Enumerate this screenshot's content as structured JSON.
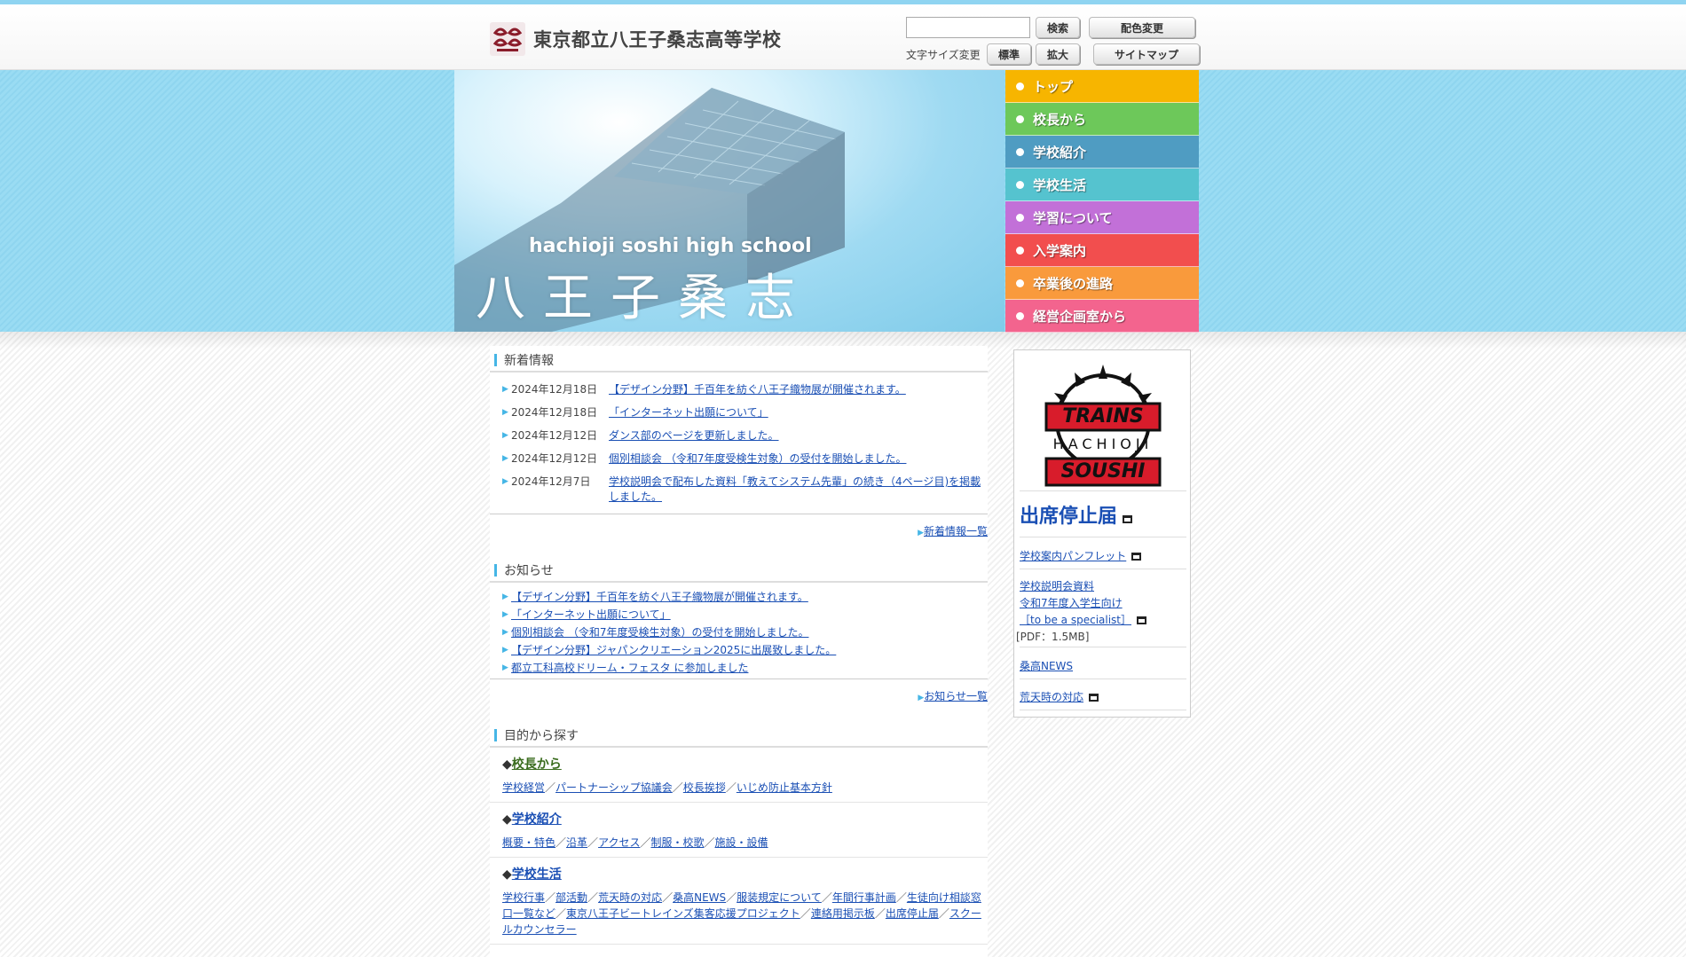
{
  "header": {
    "site_title": "東京都立八王子桑志高等学校",
    "search_placeholder": "",
    "search_button": "検索",
    "color_button": "配色変更",
    "font_size_label": "文字サイズ変更",
    "font_normal_button": "標準",
    "font_large_button": "拡大",
    "sitemap_button": "サイトマップ"
  },
  "hero": {
    "subtitle": "hachioji soshi high school",
    "title": "八王子桑志"
  },
  "nav": {
    "items": [
      {
        "label": "トップ",
        "color": "#f7b500"
      },
      {
        "label": "校長から",
        "color": "#6dc85a"
      },
      {
        "label": "学校紹介",
        "color": "#4f9cc2"
      },
      {
        "label": "学校生活",
        "color": "#55c3cf"
      },
      {
        "label": "学習について",
        "color": "#c270d8"
      },
      {
        "label": "入学案内",
        "color": "#f24e4e"
      },
      {
        "label": "卒業後の進路",
        "color": "#f99a3c"
      },
      {
        "label": "経営企画室から",
        "color": "#f3648e"
      }
    ]
  },
  "news": {
    "heading": "新着情報",
    "items": [
      {
        "date": "2024年12月18日",
        "text": "【デザイン分野】千百年を紡ぐ八王子織物展が開催されます。"
      },
      {
        "date": "2024年12月18日",
        "text": "「インターネット出願について」"
      },
      {
        "date": "2024年12月12日",
        "text": "ダンス部のページを更新しました。"
      },
      {
        "date": "2024年12月12日",
        "text": "個別相談会 （令和7年度受検生対象）の受付を開始しました。"
      },
      {
        "date": "2024年12月7日",
        "text": "学校説明会で配布した資料「教えてシステム先輩」の続き（4ページ目)を掲載しました。"
      }
    ],
    "more": "新着情報一覧"
  },
  "notices": {
    "heading": "お知らせ",
    "items": [
      "【デザイン分野】千百年を紡ぐ八王子織物展が開催されます。",
      "「インターネット出願について」",
      "個別相談会 （令和7年度受検生対象）の受付を開始しました。",
      "【デザイン分野】ジャパンクリエーション2025に出展致しました。",
      "都立工科高校ドリーム・フェスタ に参加しました"
    ],
    "more": "お知らせ一覧"
  },
  "purpose": {
    "heading": "目的から探す",
    "sections": [
      {
        "title": "校長から",
        "links": [
          "学校経営",
          "パートナーシップ協議会",
          "校長挨拶",
          "いじめ防止基本方針"
        ]
      },
      {
        "title": "学校紹介",
        "links": [
          "概要・特色",
          "沿革",
          "アクセス",
          "制服・校歌",
          "施設・設備"
        ]
      },
      {
        "title": "学校生活",
        "links": [
          "学校行事",
          "部活動",
          "荒天時の対応",
          "桑高NEWS",
          "服装規定について",
          "年間行事計画",
          "生徒向け相談窓口一覧など",
          "東京八王子ビートレインズ集客応援プロジェクト",
          "連絡用掲示板",
          "出席停止届",
          "スクールカウンセラー"
        ]
      }
    ]
  },
  "sidebar": {
    "banner": {
      "line1": "TRAINS",
      "line2": "HACHIOJI",
      "line3": "SOUSHI"
    },
    "attendance_link": "出席停止届",
    "pamphlet_link": "学校案内パンフレット",
    "briefing_lines": [
      "学校説明会資料",
      "令和7年度入学生向け",
      "［to be a specialist］"
    ],
    "briefing_size": "[PDF：1.5MB]",
    "news_link": "桑高NEWS",
    "weather_link": "荒天時の対応"
  }
}
